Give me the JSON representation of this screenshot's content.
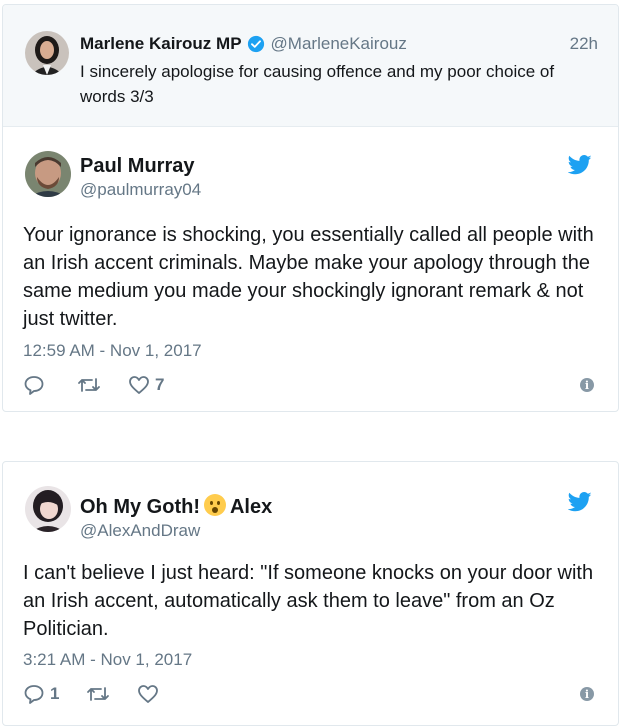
{
  "parent_tweet": {
    "name": "Marlene Kairouz MP",
    "handle": "@MarleneKairouz",
    "time": "22h",
    "text": "I sincerely apologise for causing offence and my poor choice of words 3/3"
  },
  "tweets": [
    {
      "name": "Paul Murray",
      "handle": "@paulmurray04",
      "text": "Your ignorance is shocking, you essentially called all people with an Irish accent criminals. Maybe make your apology through the same medium you made your shockingly ignorant remark & not just twitter.",
      "timestamp": "12:59 AM - Nov 1, 2017",
      "reply_count": "",
      "like_count": "7"
    },
    {
      "name_part1": "Oh My Goth!",
      "name_part2": "Alex",
      "handle": "@AlexAndDraw",
      "text": "I can't believe I just heard: \"If someone knocks on your door with an Irish accent, automatically ask them to leave\" from an Oz Politician.",
      "timestamp": "3:21 AM - Nov 1, 2017",
      "reply_count": "1",
      "like_count": ""
    }
  ],
  "icons": {
    "reply": "reply-icon",
    "retweet": "retweet-icon",
    "like": "heart-icon",
    "info": "info-icon",
    "twitter": "twitter-bird-icon",
    "verified": "verified-badge-icon"
  },
  "colors": {
    "twitter_blue": "#1da1f2",
    "secondary_text": "#657786",
    "parent_bg": "#f5f8fa"
  }
}
